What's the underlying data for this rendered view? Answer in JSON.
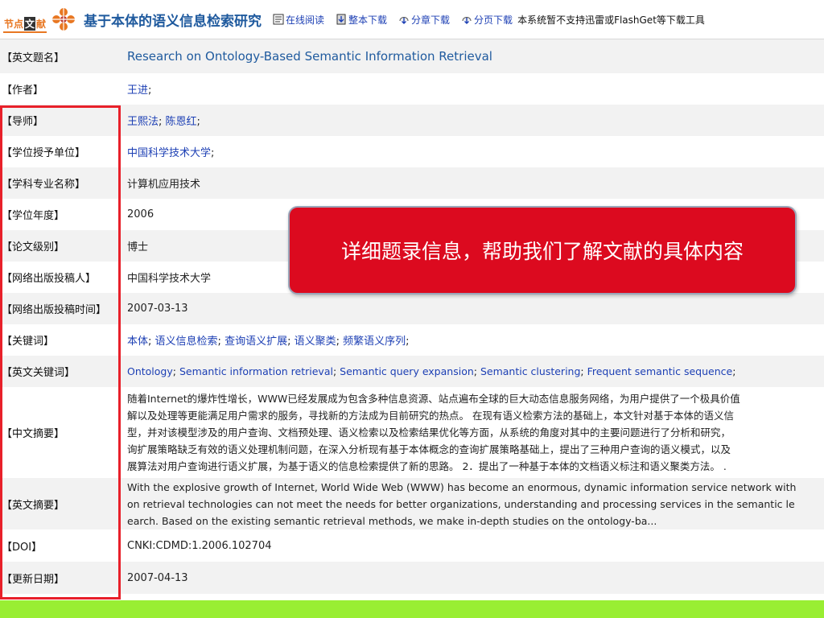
{
  "logo": {
    "text_1": "节点",
    "text_2": "文",
    "text_3": "献"
  },
  "header": {
    "title": "基于本体的语义信息检索研究",
    "tools": [
      {
        "label": "在线阅读",
        "icon": "book-icon"
      },
      {
        "label": "整本下载",
        "icon": "download-book-icon"
      },
      {
        "label": "分章下载",
        "icon": "download-chapter-icon"
      },
      {
        "label": "分页下载",
        "icon": "download-page-icon"
      }
    ],
    "notice": "本系统暂不支持迅雷或FlashGet等下载工具"
  },
  "record": {
    "en_title": {
      "label": "【英文题名】",
      "value": "Research on Ontology-Based Semantic Information Retrieval"
    },
    "author": {
      "label": "【作者】",
      "links": [
        "王进"
      ]
    },
    "advisor": {
      "label": "【导师】",
      "links": [
        "王熙法",
        "陈恩红"
      ]
    },
    "institution": {
      "label": "【学位授予单位】",
      "links": [
        "中国科学技术大学"
      ]
    },
    "major": {
      "label": "【学科专业名称】",
      "value": "计算机应用技术"
    },
    "year": {
      "label": "【学位年度】",
      "value": "2006"
    },
    "level": {
      "label": "【论文级别】",
      "value": "博士"
    },
    "submitter": {
      "label": "【网络出版投稿人】",
      "value": "中国科学技术大学"
    },
    "submit_time": {
      "label": "【网络出版投稿时间】",
      "value": "2007-03-13"
    },
    "keywords": {
      "label": "【关键词】",
      "links": [
        "本体",
        "语义信息检索",
        "查询语义扩展",
        "语义聚类",
        "频繁语义序列"
      ]
    },
    "en_keywords": {
      "label": "【英文关键词】",
      "links": [
        "Ontology",
        "Semantic information retrieval",
        "Semantic query expansion",
        "Semantic clustering",
        "Frequent semantic sequence"
      ]
    },
    "cn_abstract": {
      "label": "【中文摘要】",
      "lines": [
        "随着Internet的爆炸性增长，WWW已经发展成为包含多种信息资源、站点遍布全球的巨大动态信息服务网络，为用户提供了一个极具价值",
        "解以及处理等更能满足用户需求的服务，寻找新的方法成为目前研究的热点。 在现有语义检索方法的基础上，本文针对基于本体的语义信",
        "型，并对该模型涉及的用户查询、文档预处理、语义检索以及检索结果优化等方面，从系统的角度对其中的主要问题进行了分析和研究，",
        "询扩展策略缺乏有效的语义处理机制问题，在深入分析现有基于本体概念的查询扩展策略基础上，提出了三种用户查询的语义模式，以及",
        "展算法对用户查询进行语义扩展，为基于语义的信息检索提供了新的思路。 2．提出了一种基于本体的文档语义标注和语义聚类方法。 ."
      ]
    },
    "en_abstract": {
      "label": "【英文摘要】",
      "lines": [
        "With the explosive growth of Internet, World Wide Web (WWW) has become an enormous, dynamic information service network with",
        "on retrieval technologies can not meet the needs for better organizations, understanding and processing services in the semantic le",
        "earch. Based on the existing semantic retrieval methods, we make in-depth studies on the ontology-ba..."
      ]
    },
    "doi": {
      "label": "【DOI】",
      "value": "CNKI:CDMD:1.2006.102704"
    },
    "update_date": {
      "label": "【更新日期】",
      "value": "2007-04-13"
    }
  },
  "callout": {
    "text": "详细题录信息，帮助我们了解文献的具体内容"
  },
  "colors": {
    "title_blue": "#1f5a9e",
    "link_blue": "#1c3fb4",
    "highlight_red": "#e8202a",
    "callout_red": "#dc0a1f",
    "bottom_green": "#99ee33",
    "logo_orange": "#e87722"
  }
}
